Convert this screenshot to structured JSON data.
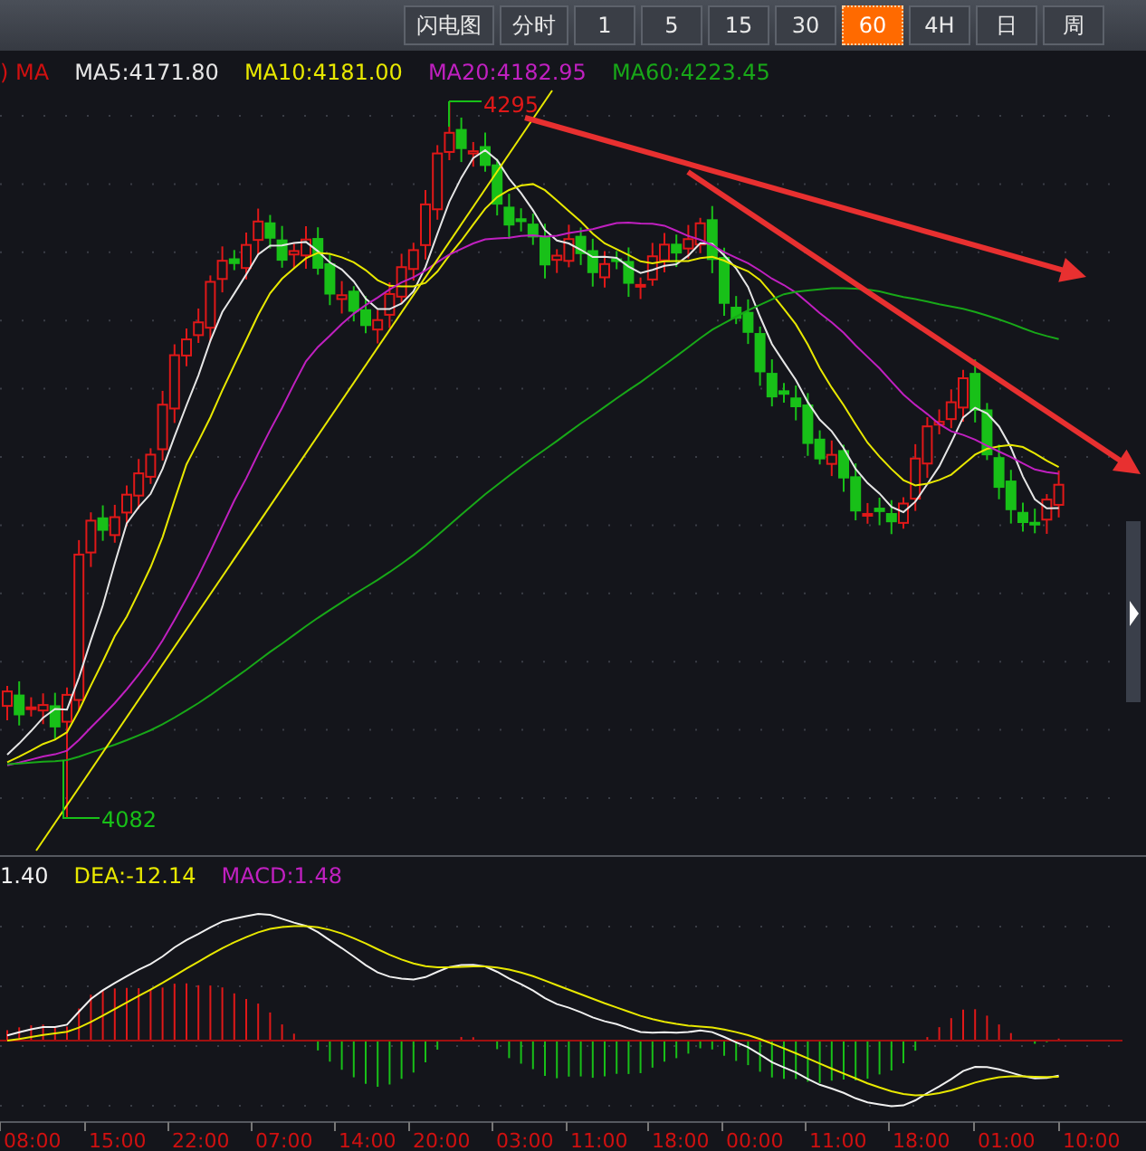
{
  "toolbar": {
    "buttons": [
      {
        "label": "闪电图",
        "selected": false
      },
      {
        "label": "分时",
        "selected": false
      },
      {
        "label": "1",
        "selected": false
      },
      {
        "label": "5",
        "selected": false
      },
      {
        "label": "15",
        "selected": false
      },
      {
        "label": "30",
        "selected": false
      },
      {
        "label": "60",
        "selected": true
      },
      {
        "label": "4H",
        "selected": false
      },
      {
        "label": "日",
        "selected": false
      },
      {
        "label": "周",
        "selected": false
      }
    ]
  },
  "price_legend": {
    "prefix": ") MA",
    "items": [
      {
        "label": "MA5:4171.80",
        "color": "#e6e6e6"
      },
      {
        "label": "MA10:4181.00",
        "color": "#e8e800"
      },
      {
        "label": "MA20:4182.95",
        "color": "#c020c0"
      },
      {
        "label": "MA60:4223.45",
        "color": "#18a818"
      }
    ]
  },
  "price_markers": {
    "high": "4295",
    "low": "4082"
  },
  "macd_legend": [
    {
      "label": "1.40",
      "color": "#f0f0f0"
    },
    {
      "label": "DEA:-12.14",
      "color": "#e8e800"
    },
    {
      "label": "MACD:1.48",
      "color": "#c020c0"
    }
  ],
  "time_axis": [
    "08:00",
    "15:00",
    "22:00",
    "07:00",
    "14:00",
    "20:00",
    "03:00",
    "11:00",
    "18:00",
    "00:00",
    "11:00",
    "18:00",
    "01:00",
    "10:00"
  ]
}
